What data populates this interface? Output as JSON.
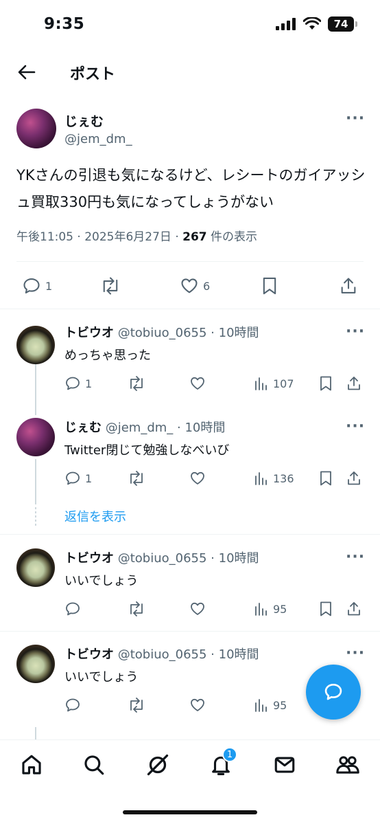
{
  "status_bar": {
    "time": "9:35",
    "battery": "74"
  },
  "header": {
    "title": "ポスト"
  },
  "post": {
    "name": "じぇむ",
    "handle": "@jem_dm_",
    "text": "YKさんの引退も気になるけど、レシートのガイアッシュ買取330円も気になってしょうがない",
    "meta_time": "午後11:05 · 2025年6月27日 · ",
    "views": "267",
    "views_suffix": " 件の表示",
    "replies": "1",
    "likes": "6"
  },
  "replies": [
    {
      "name": "トビウオ",
      "sub": " @tobiuo_0655 · 10時間",
      "text": "めっちゃ思った",
      "replies": "1",
      "views": "107"
    },
    {
      "name": "じぇむ",
      "sub": " @jem_dm_ · 10時間",
      "text": "Twitter閉じて勉強しなべいび",
      "replies": "1",
      "views": "136"
    },
    {
      "name": "トビウオ",
      "sub": " @tobiuo_0655 · 10時間",
      "text": "いいでしょう",
      "replies": "",
      "views": "95"
    },
    {
      "name": "トビウオ",
      "sub": " @tobiuo_0655 · 10時間",
      "text": "いいでしょう",
      "replies": "",
      "views": "95"
    }
  ],
  "show_replies_label": "返信を表示",
  "tabbar": {
    "notifications_badge": "1"
  },
  "colors": {
    "accent": "#1d9bf0",
    "secondary_text": "#536471"
  }
}
